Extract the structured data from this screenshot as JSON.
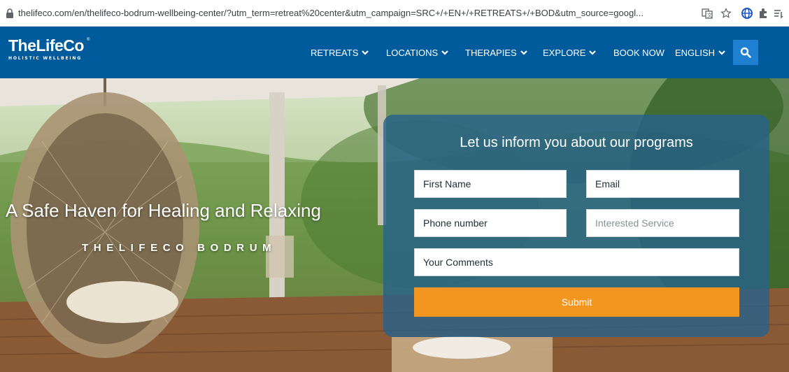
{
  "browser": {
    "url": "thelifeco.com/en/thelifeco-bodrum-wellbeing-center/?utm_term=retreat%20center&utm_campaign=SRC+/+EN+/+RETREATS+/+BOD&utm_source=googl..."
  },
  "nav": {
    "logo_name": "TheLifeCo",
    "logo_tagline": "HOLISTIC WELLBEING",
    "logo_mark": "®",
    "items": [
      {
        "label": "RETREATS"
      },
      {
        "label": "LOCATIONS"
      },
      {
        "label": "THERAPIES"
      },
      {
        "label": "EXPLORE"
      },
      {
        "label": "BOOK NOW"
      },
      {
        "label": "ENGLISH"
      }
    ]
  },
  "hero": {
    "title": "A Safe Haven for Healing and Relaxing",
    "subtitle": "THELIFECO BODRUM"
  },
  "form": {
    "title": "Let us inform you about our programs",
    "first_name": "First Name",
    "email": "Email",
    "phone": "Phone number",
    "interested_service": "Interested Service",
    "comments": "Your Comments",
    "submit": "Submit"
  },
  "colors": {
    "nav_bg": "#005b9c",
    "search_bg": "#1f7fd1",
    "submit_bg": "#f39620",
    "panel_bg": "#25628c"
  },
  "icons": [
    "lock-icon",
    "translate-icon",
    "star-icon",
    "profile-icon",
    "extensions-icon",
    "reading-list-icon",
    "search-icon",
    "chevron-down-icon"
  ]
}
